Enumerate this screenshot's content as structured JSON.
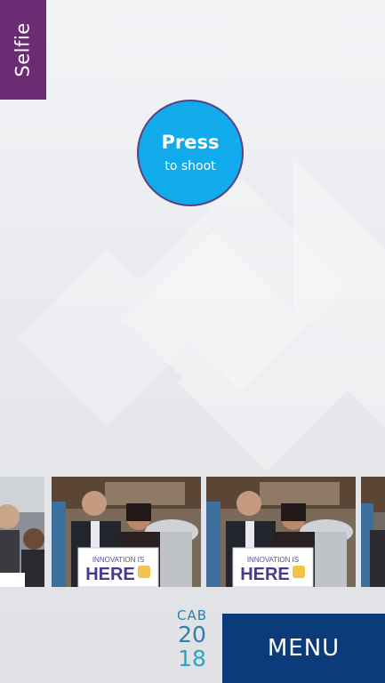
{
  "mode_tab": {
    "label": "Selfie"
  },
  "shutter": {
    "line1": "Press",
    "line2": "to shoot"
  },
  "gallery": {
    "photos": [
      {
        "sign_top": "INNOVATION IS",
        "sign_main": "HERE"
      },
      {
        "sign_top": "INNOVATION IS",
        "sign_main": "HERE"
      }
    ]
  },
  "logo": {
    "line1": "CAB",
    "line2": "20",
    "line3": "18"
  },
  "menu": {
    "label": "MENU"
  },
  "colors": {
    "mode_tab": "#6b2c74",
    "shutter": "#11aaea",
    "menu": "#0b3b7a",
    "logo": "#2f7fa6"
  }
}
